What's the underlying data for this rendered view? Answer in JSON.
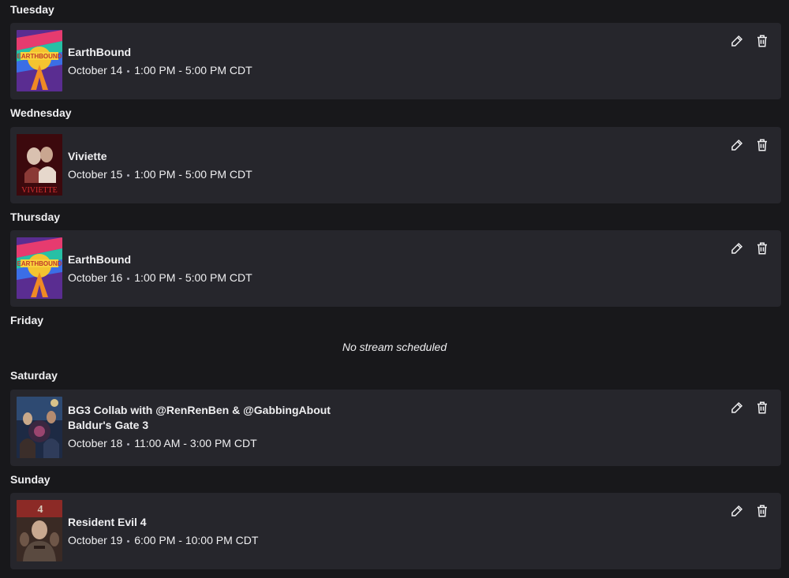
{
  "schedule": [
    {
      "day": "Tuesday",
      "title": "EarthBound",
      "subtitle": "",
      "date": "October 14",
      "time": "1:00 PM - 5:00 PM CDT",
      "cover_icon": "earthbound-cover"
    },
    {
      "day": "Wednesday",
      "title": "Viviette",
      "subtitle": "",
      "date": "October 15",
      "time": "1:00 PM - 5:00 PM CDT",
      "cover_icon": "viviette-cover"
    },
    {
      "day": "Thursday",
      "title": "EarthBound",
      "subtitle": "",
      "date": "October 16",
      "time": "1:00 PM - 5:00 PM CDT",
      "cover_icon": "earthbound-cover"
    },
    {
      "day": "Friday",
      "empty_text": "No stream scheduled"
    },
    {
      "day": "Saturday",
      "title": "BG3 Collab with @RenRenBen & @GabbingAbout",
      "subtitle": "Baldur's Gate 3",
      "date": "October 18",
      "time": "11:00 AM - 3:00 PM CDT",
      "cover_icon": "baldurs-gate-3-cover"
    },
    {
      "day": "Sunday",
      "title": "Resident Evil 4",
      "subtitle": "",
      "date": "October 19",
      "time": "6:00 PM - 10:00 PM CDT",
      "cover_icon": "resident-evil-4-cover"
    }
  ],
  "icons": {
    "edit": "pencil-icon",
    "delete": "trash-icon"
  },
  "colors": {
    "background": "#18181b",
    "card": "#26262c",
    "text": "#efeff1"
  }
}
